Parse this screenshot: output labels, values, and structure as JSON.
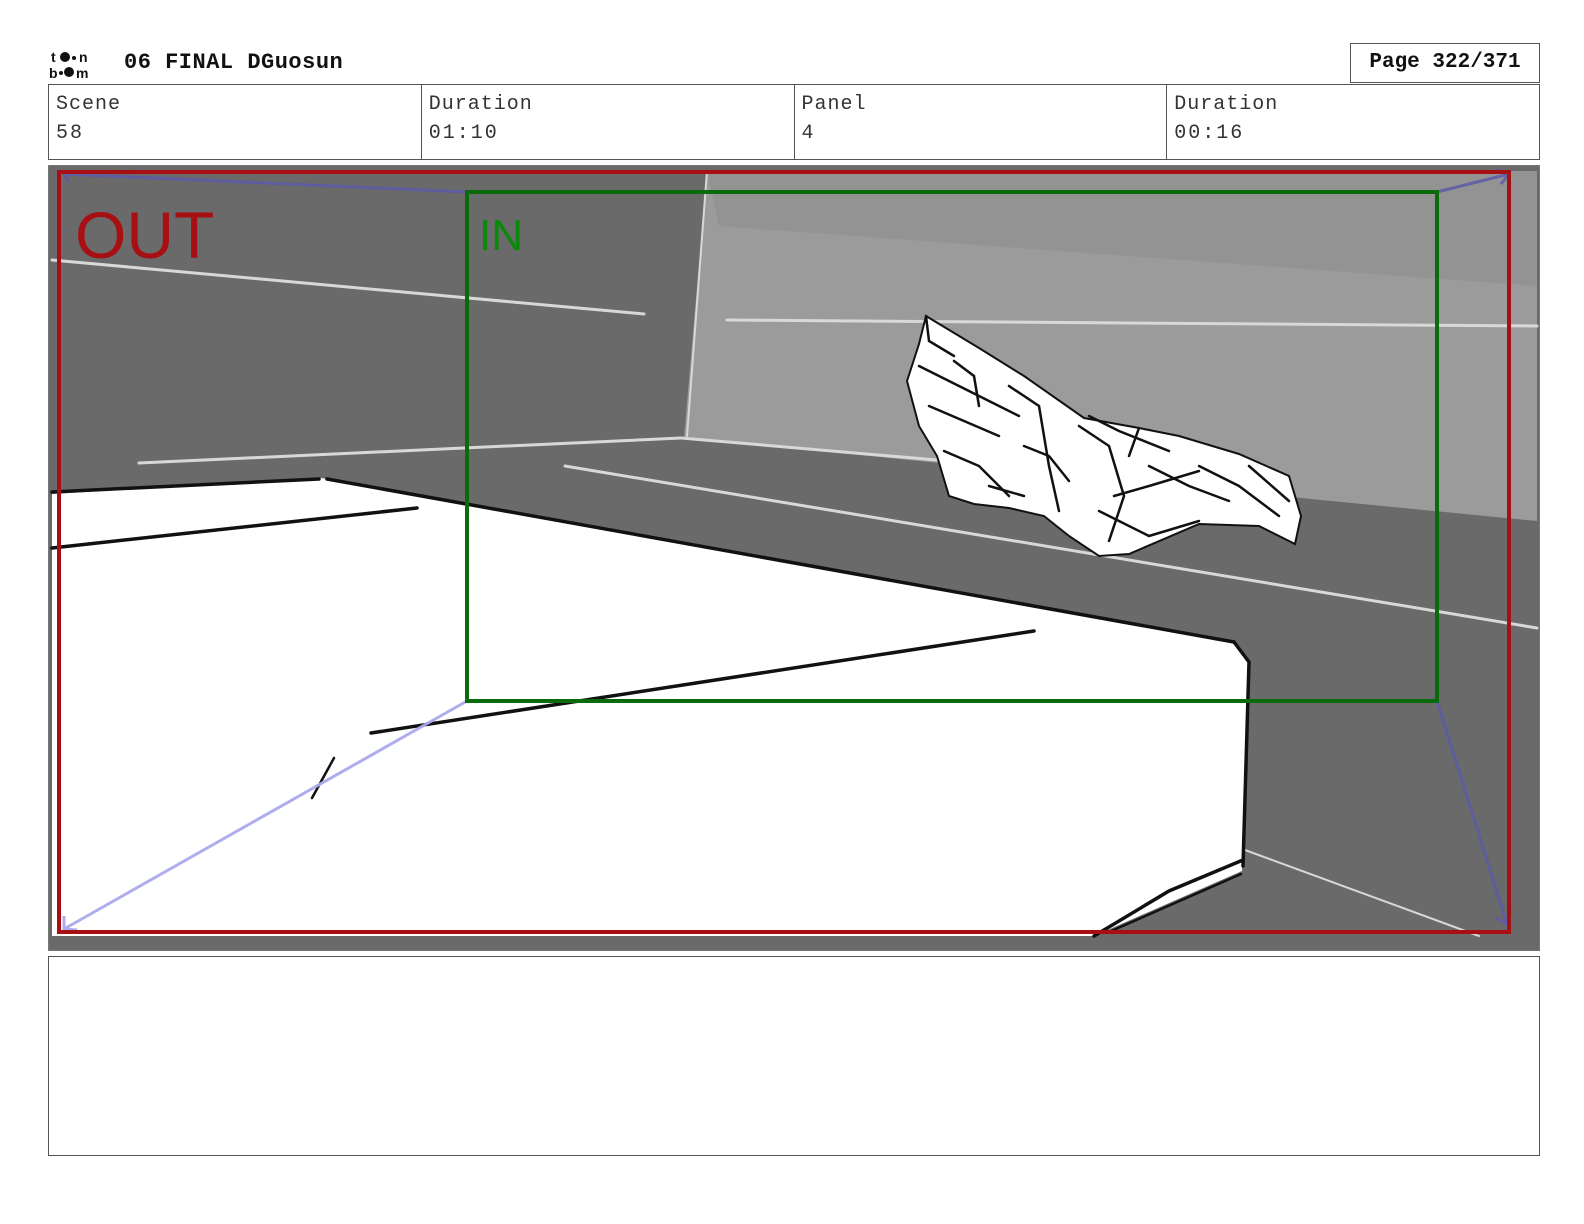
{
  "header": {
    "logo_alt": "toon boom",
    "title": "06 FINAL DGuosun",
    "page_label": "Page 322/371"
  },
  "info": {
    "scene_label": "Scene",
    "scene_value": "58",
    "scene_duration_label": "Duration",
    "scene_duration_value": "01:10",
    "panel_label": "Panel",
    "panel_value": "4",
    "panel_duration_label": "Duration",
    "panel_duration_value": "00:16"
  },
  "panel": {
    "out_label": "OUT",
    "in_label": "IN",
    "out_color": "#a80f12",
    "in_color": "#0a6b0a",
    "arrow_color": "#5a5aa8"
  },
  "notes": {
    "text": ""
  }
}
